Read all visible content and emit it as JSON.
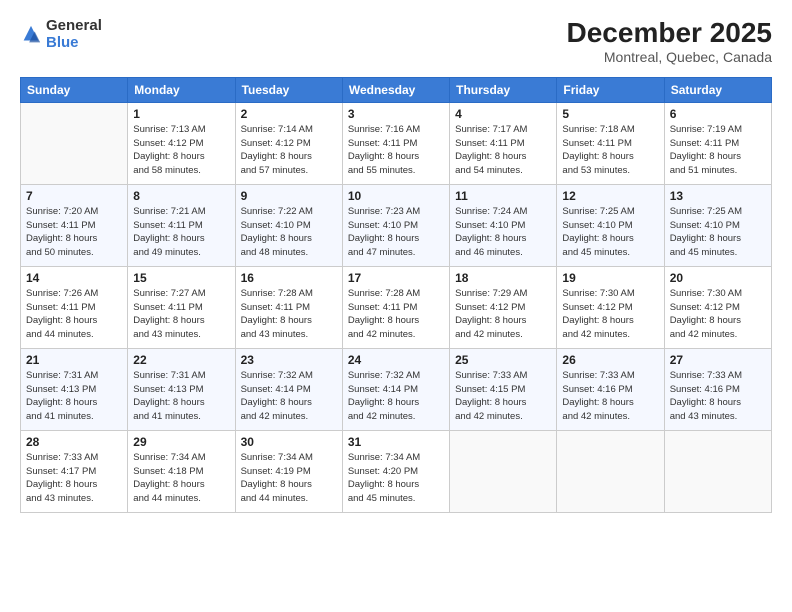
{
  "logo": {
    "general": "General",
    "blue": "Blue"
  },
  "title": "December 2025",
  "location": "Montreal, Quebec, Canada",
  "days_header": [
    "Sunday",
    "Monday",
    "Tuesday",
    "Wednesday",
    "Thursday",
    "Friday",
    "Saturday"
  ],
  "weeks": [
    [
      {
        "day": "",
        "info": ""
      },
      {
        "day": "1",
        "info": "Sunrise: 7:13 AM\nSunset: 4:12 PM\nDaylight: 8 hours\nand 58 minutes."
      },
      {
        "day": "2",
        "info": "Sunrise: 7:14 AM\nSunset: 4:12 PM\nDaylight: 8 hours\nand 57 minutes."
      },
      {
        "day": "3",
        "info": "Sunrise: 7:16 AM\nSunset: 4:11 PM\nDaylight: 8 hours\nand 55 minutes."
      },
      {
        "day": "4",
        "info": "Sunrise: 7:17 AM\nSunset: 4:11 PM\nDaylight: 8 hours\nand 54 minutes."
      },
      {
        "day": "5",
        "info": "Sunrise: 7:18 AM\nSunset: 4:11 PM\nDaylight: 8 hours\nand 53 minutes."
      },
      {
        "day": "6",
        "info": "Sunrise: 7:19 AM\nSunset: 4:11 PM\nDaylight: 8 hours\nand 51 minutes."
      }
    ],
    [
      {
        "day": "7",
        "info": "Sunrise: 7:20 AM\nSunset: 4:11 PM\nDaylight: 8 hours\nand 50 minutes."
      },
      {
        "day": "8",
        "info": "Sunrise: 7:21 AM\nSunset: 4:11 PM\nDaylight: 8 hours\nand 49 minutes."
      },
      {
        "day": "9",
        "info": "Sunrise: 7:22 AM\nSunset: 4:10 PM\nDaylight: 8 hours\nand 48 minutes."
      },
      {
        "day": "10",
        "info": "Sunrise: 7:23 AM\nSunset: 4:10 PM\nDaylight: 8 hours\nand 47 minutes."
      },
      {
        "day": "11",
        "info": "Sunrise: 7:24 AM\nSunset: 4:10 PM\nDaylight: 8 hours\nand 46 minutes."
      },
      {
        "day": "12",
        "info": "Sunrise: 7:25 AM\nSunset: 4:10 PM\nDaylight: 8 hours\nand 45 minutes."
      },
      {
        "day": "13",
        "info": "Sunrise: 7:25 AM\nSunset: 4:10 PM\nDaylight: 8 hours\nand 45 minutes."
      }
    ],
    [
      {
        "day": "14",
        "info": "Sunrise: 7:26 AM\nSunset: 4:11 PM\nDaylight: 8 hours\nand 44 minutes."
      },
      {
        "day": "15",
        "info": "Sunrise: 7:27 AM\nSunset: 4:11 PM\nDaylight: 8 hours\nand 43 minutes."
      },
      {
        "day": "16",
        "info": "Sunrise: 7:28 AM\nSunset: 4:11 PM\nDaylight: 8 hours\nand 43 minutes."
      },
      {
        "day": "17",
        "info": "Sunrise: 7:28 AM\nSunset: 4:11 PM\nDaylight: 8 hours\nand 42 minutes."
      },
      {
        "day": "18",
        "info": "Sunrise: 7:29 AM\nSunset: 4:12 PM\nDaylight: 8 hours\nand 42 minutes."
      },
      {
        "day": "19",
        "info": "Sunrise: 7:30 AM\nSunset: 4:12 PM\nDaylight: 8 hours\nand 42 minutes."
      },
      {
        "day": "20",
        "info": "Sunrise: 7:30 AM\nSunset: 4:12 PM\nDaylight: 8 hours\nand 42 minutes."
      }
    ],
    [
      {
        "day": "21",
        "info": "Sunrise: 7:31 AM\nSunset: 4:13 PM\nDaylight: 8 hours\nand 41 minutes."
      },
      {
        "day": "22",
        "info": "Sunrise: 7:31 AM\nSunset: 4:13 PM\nDaylight: 8 hours\nand 41 minutes."
      },
      {
        "day": "23",
        "info": "Sunrise: 7:32 AM\nSunset: 4:14 PM\nDaylight: 8 hours\nand 42 minutes."
      },
      {
        "day": "24",
        "info": "Sunrise: 7:32 AM\nSunset: 4:14 PM\nDaylight: 8 hours\nand 42 minutes."
      },
      {
        "day": "25",
        "info": "Sunrise: 7:33 AM\nSunset: 4:15 PM\nDaylight: 8 hours\nand 42 minutes."
      },
      {
        "day": "26",
        "info": "Sunrise: 7:33 AM\nSunset: 4:16 PM\nDaylight: 8 hours\nand 42 minutes."
      },
      {
        "day": "27",
        "info": "Sunrise: 7:33 AM\nSunset: 4:16 PM\nDaylight: 8 hours\nand 43 minutes."
      }
    ],
    [
      {
        "day": "28",
        "info": "Sunrise: 7:33 AM\nSunset: 4:17 PM\nDaylight: 8 hours\nand 43 minutes."
      },
      {
        "day": "29",
        "info": "Sunrise: 7:34 AM\nSunset: 4:18 PM\nDaylight: 8 hours\nand 44 minutes."
      },
      {
        "day": "30",
        "info": "Sunrise: 7:34 AM\nSunset: 4:19 PM\nDaylight: 8 hours\nand 44 minutes."
      },
      {
        "day": "31",
        "info": "Sunrise: 7:34 AM\nSunset: 4:20 PM\nDaylight: 8 hours\nand 45 minutes."
      },
      {
        "day": "",
        "info": ""
      },
      {
        "day": "",
        "info": ""
      },
      {
        "day": "",
        "info": ""
      }
    ]
  ]
}
